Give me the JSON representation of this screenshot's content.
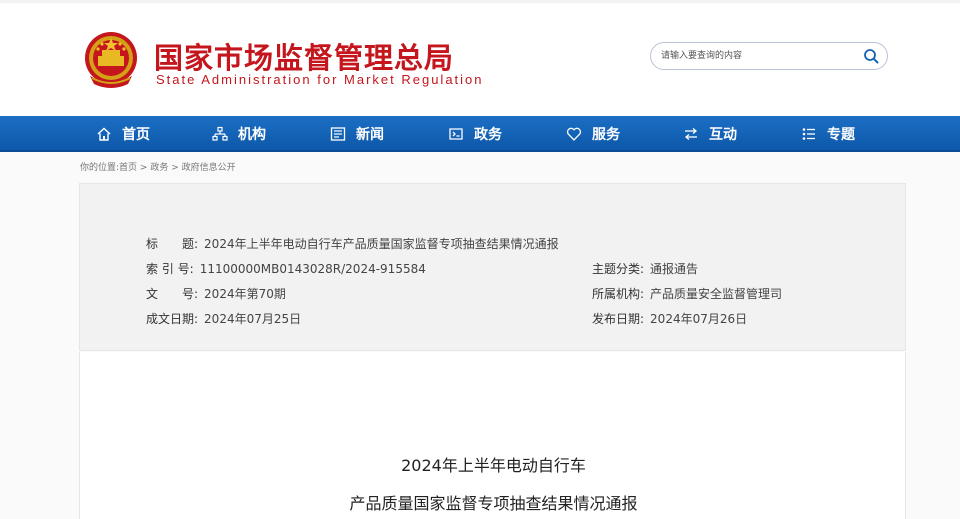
{
  "header": {
    "title_cn": "国家市场监督管理总局",
    "title_en": "State Administration for Market Regulation",
    "search_placeholder": "请输入要查询的内容"
  },
  "nav": {
    "items": [
      {
        "label": "首页",
        "icon": "home-icon"
      },
      {
        "label": "机构",
        "icon": "org-icon"
      },
      {
        "label": "新闻",
        "icon": "news-icon"
      },
      {
        "label": "政务",
        "icon": "affairs-icon"
      },
      {
        "label": "服务",
        "icon": "heart-icon"
      },
      {
        "label": "互动",
        "icon": "exchange-icon"
      },
      {
        "label": "专题",
        "icon": "list-icon"
      }
    ]
  },
  "breadcrumb": {
    "prefix": "你的位置:",
    "items": [
      "首页",
      "政务",
      "政府信息公开"
    ],
    "separator": " > "
  },
  "info": {
    "title_label": "标　　题:",
    "title_value": "2024年上半年电动自行车产品质量国家监督专项抽查结果情况通报",
    "index_label": "索 引 号:",
    "index_value": "11100000MB0143028R/2024-915584",
    "category_label": "主题分类:",
    "category_value": "通报通告",
    "doc_no_label": "文　　号:",
    "doc_no_value": "2024年第70期",
    "agency_label": "所属机构:",
    "agency_value": "产品质量安全监督管理司",
    "created_label": "成文日期:",
    "created_value": "2024年07月25日",
    "published_label": "发布日期:",
    "published_value": "2024年07月26日"
  },
  "document": {
    "heading_line1": "2024年上半年电动自行车",
    "heading_line2": "产品质量国家监督专项抽查结果情况通报"
  },
  "colors": {
    "brand_red": "#c4161c",
    "nav_blue": "#1464b4"
  }
}
